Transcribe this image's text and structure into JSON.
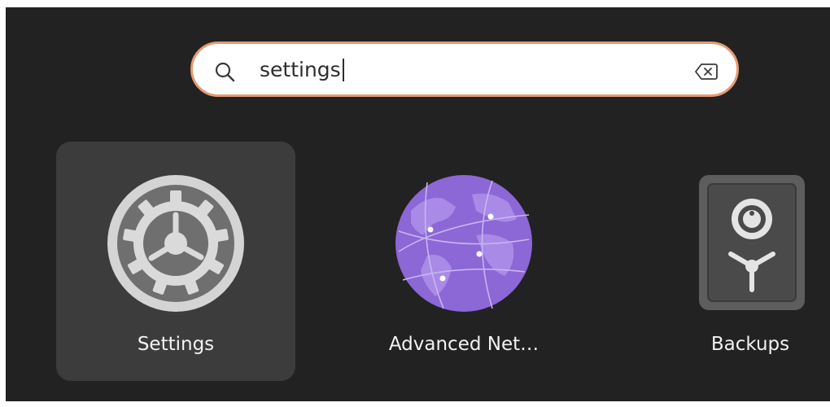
{
  "search": {
    "query": "settings",
    "icon": "search-icon",
    "clear_icon": "backspace-clear-icon"
  },
  "results": [
    {
      "label": "Settings",
      "icon": "settings-gear-icon",
      "selected": true
    },
    {
      "label": "Advanced Net…",
      "icon": "network-globe-icon",
      "selected": false
    },
    {
      "label": "Backups",
      "icon": "backups-safe-icon",
      "selected": false
    }
  ],
  "colors": {
    "background": "#222222",
    "search_border": "#e59a72",
    "selected_tile": "#3c3c3c",
    "globe_purple": "#8c67d6"
  }
}
